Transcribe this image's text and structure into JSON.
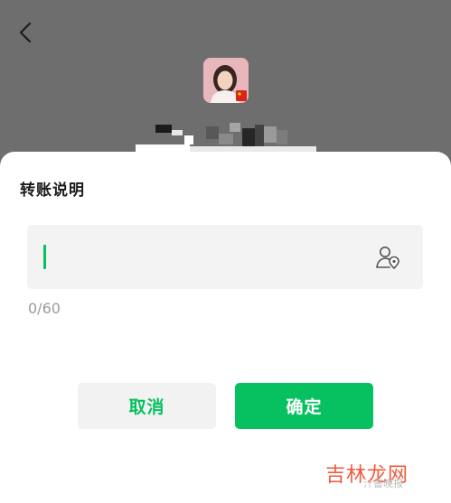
{
  "transfer_note": {
    "title": "转账说明",
    "input_value": "",
    "input_placeholder": "",
    "char_counter": "0/60",
    "cancel_label": "取消",
    "confirm_label": "确定"
  },
  "watermark": {
    "main": "吉林龙网",
    "sub": "汁書晚报"
  },
  "colors": {
    "accent": "#07c160",
    "overlay": "#6e6e6e",
    "input_bg": "#f3f3f3",
    "watermark": "#ee5a3c"
  },
  "icons": {
    "back": "chevron-left-icon",
    "contact": "contact-location-icon"
  }
}
